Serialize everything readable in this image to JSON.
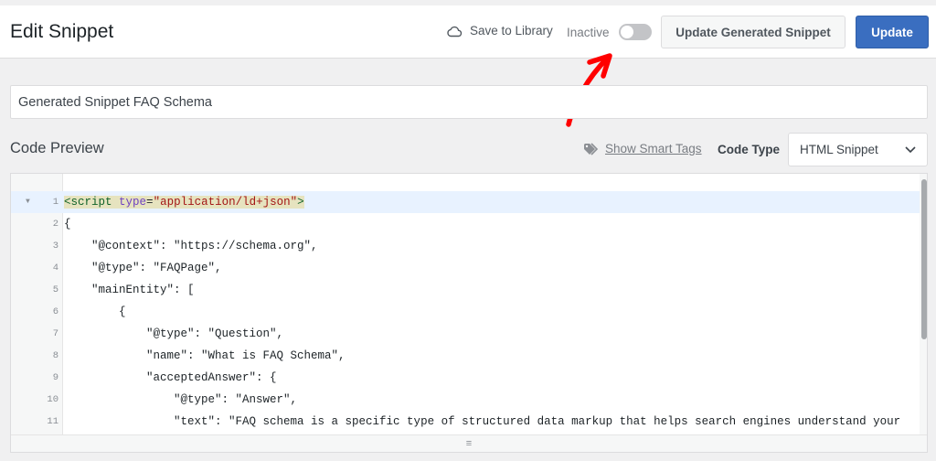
{
  "header": {
    "title": "Edit Snippet",
    "save_to_library": "Save to Library",
    "status_label": "Inactive",
    "toggle_active": false,
    "update_generated_label": "Update Generated Snippet",
    "update_label": "Update"
  },
  "snippet": {
    "title_value": "Generated Snippet FAQ Schema"
  },
  "code_preview": {
    "label": "Code Preview",
    "smart_tags_link": "Show Smart Tags",
    "code_type_label": "Code Type",
    "code_type_value": "HTML Snippet"
  },
  "editor": {
    "lines": [
      {
        "num": "1",
        "text": "<script type=\"application/ld+json\">"
      },
      {
        "num": "2",
        "text": "{"
      },
      {
        "num": "3",
        "text": "    \"@context\": \"https://schema.org\","
      },
      {
        "num": "4",
        "text": "    \"@type\": \"FAQPage\","
      },
      {
        "num": "5",
        "text": "    \"mainEntity\": ["
      },
      {
        "num": "6",
        "text": "        {"
      },
      {
        "num": "7",
        "text": "            \"@type\": \"Question\","
      },
      {
        "num": "8",
        "text": "            \"name\": \"What is FAQ Schema\","
      },
      {
        "num": "9",
        "text": "            \"acceptedAnswer\": {"
      },
      {
        "num": "10",
        "text": "                \"@type\": \"Answer\","
      },
      {
        "num": "11",
        "text": "                \"text\": \"FAQ schema is a specific type of structured data markup that helps search engines understand your"
      }
    ]
  },
  "colors": {
    "primary": "#3a6ec0",
    "annotation_arrow": "#ff0000",
    "active_line": "#e8f2ff"
  },
  "icons": {
    "save": "cloud-icon",
    "smart_tags": "tags-icon",
    "select": "chevron-down-icon",
    "fold": "fold-arrow-icon",
    "resize": "resize-handle-icon"
  }
}
